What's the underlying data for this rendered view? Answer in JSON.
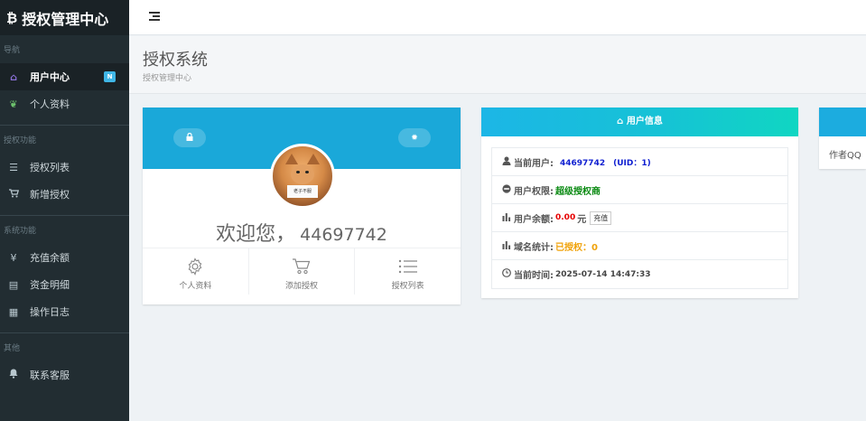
{
  "app": {
    "title": "授权管理中心",
    "logo_glyph": "₿"
  },
  "sidebar": {
    "sections": [
      {
        "title": "导航",
        "items": [
          {
            "label": "用户中心",
            "icon": "home-icon",
            "active": true,
            "badge": "N"
          },
          {
            "label": "个人资料",
            "icon": "leaf-icon"
          }
        ]
      },
      {
        "title": "授权功能",
        "items": [
          {
            "label": "授权列表",
            "icon": "list-icon"
          },
          {
            "label": "新增授权",
            "icon": "cart-icon"
          }
        ]
      },
      {
        "title": "系统功能",
        "items": [
          {
            "label": "充值余额",
            "icon": "yen-icon"
          },
          {
            "label": "资金明细",
            "icon": "table-icon"
          },
          {
            "label": "操作日志",
            "icon": "calendar-icon"
          }
        ]
      },
      {
        "title": "其他",
        "items": [
          {
            "label": "联系客服",
            "icon": "bell-icon"
          }
        ]
      }
    ]
  },
  "header": {
    "title": "授权系统",
    "subtitle": "授权管理中心"
  },
  "profile": {
    "welcome": "欢迎您，",
    "user_number": "44697742",
    "avatar_sign": "老子不服",
    "actions": [
      {
        "label": "个人资料",
        "icon": "gear-icon"
      },
      {
        "label": "添加授权",
        "icon": "cart-icon"
      },
      {
        "label": "授权列表",
        "icon": "list-icon"
      }
    ]
  },
  "user_info": {
    "header": "用户信息",
    "rows": {
      "current_user_label": "当前用户:",
      "current_user_value": "44697742　(UID：1)",
      "permission_label": "用户权限:",
      "permission_value": "超级授权商",
      "balance_label": "用户余额:",
      "balance_amount": "0.00",
      "balance_unit": "元",
      "recharge_button": "充值",
      "domain_label": "域名统计:",
      "domain_value": "已授权：0",
      "time_label": "当前时间:",
      "time_value": "2025-07-14 14:47:33"
    }
  },
  "author_card": {
    "text": "作者QQ"
  },
  "colors": {
    "sidebar_bg": "#222d32",
    "banner": "#1aa8d9",
    "info_header_start": "#1cb6e6",
    "info_header_end": "#10d6c2",
    "uid_blue": "#0f1fd1",
    "permission_green": "#0a8a12",
    "balance_red": "#e60000",
    "domain_orange": "#f0a20a"
  }
}
